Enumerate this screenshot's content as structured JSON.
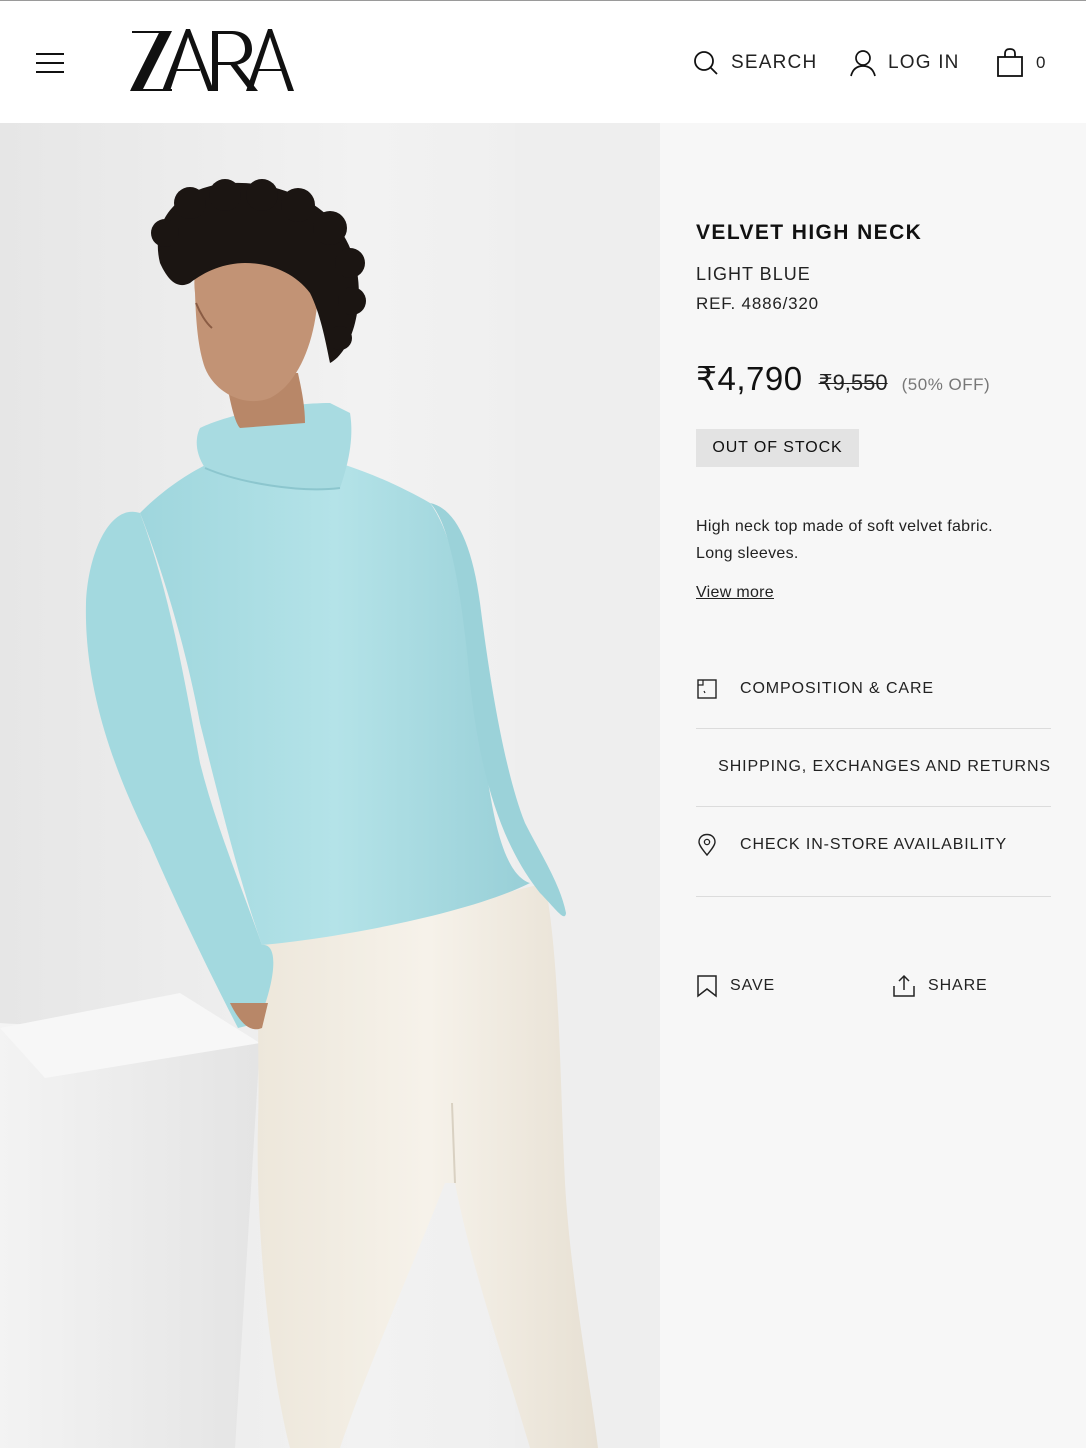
{
  "header": {
    "brand": "ZARA",
    "menu_icon": "hamburger-menu-icon",
    "search_label": "SEARCH",
    "login_label": "LOG IN",
    "bag_count": "0"
  },
  "product": {
    "title": "VELVET HIGH NECK",
    "color": "LIGHT BLUE",
    "ref": "REF. 4886/320",
    "price": "₹4,790",
    "old_price": "₹9,550",
    "discount": "(50% OFF)",
    "stock_status": "OUT OF STOCK",
    "description": "High neck top made of soft velvet fabric. Long sleeves.",
    "view_more": "View more"
  },
  "info_rows": [
    {
      "label": "COMPOSITION & CARE",
      "icon": "composition-care-icon"
    },
    {
      "label": "SHIPPING, EXCHANGES AND RETURNS",
      "icon": "truck-icon"
    },
    {
      "label": "CHECK IN-STORE AVAILABILITY",
      "icon": "location-pin-icon"
    }
  ],
  "actions": {
    "save_label": "SAVE",
    "share_label": "SHARE"
  },
  "colors": {
    "sweater": "#a9dde3",
    "pants": "#f1ece2",
    "panel_bg": "#f7f7f7",
    "badge_bg": "#e3e3e3"
  }
}
